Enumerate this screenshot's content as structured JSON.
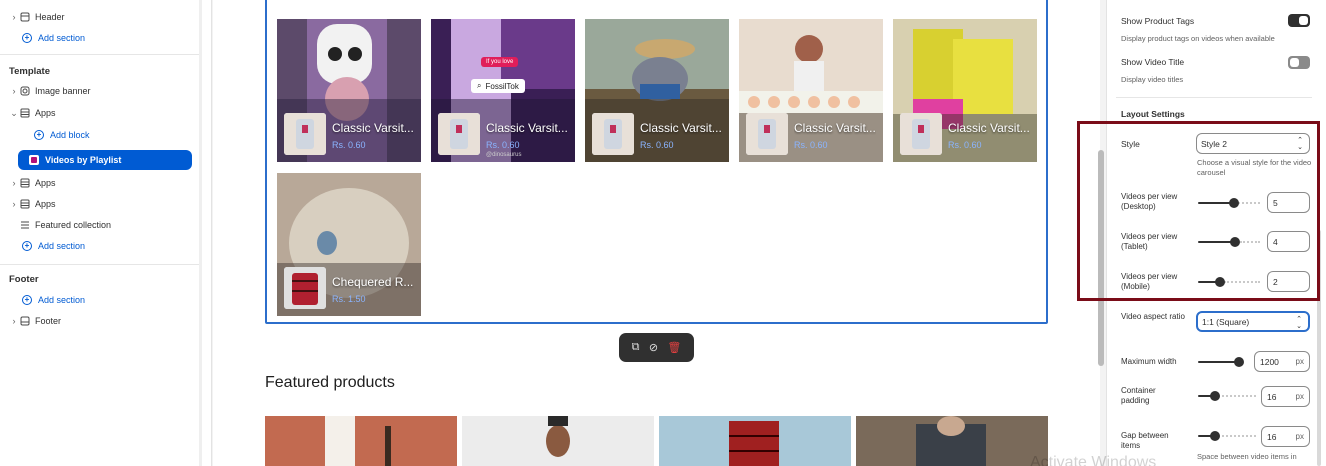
{
  "sidebar": {
    "header_item": "Header",
    "add_section_1": "Add section",
    "template_label": "Template",
    "image_banner": "Image banner",
    "apps_1": "Apps",
    "add_block": "Add block",
    "videos_by_playlist": "Videos by Playlist",
    "apps_2": "Apps",
    "apps_3": "Apps",
    "featured_collection": "Featured collection",
    "add_section_2": "Add section",
    "footer_label": "Footer",
    "add_section_3": "Add section",
    "footer_item": "Footer"
  },
  "preview": {
    "videos": [
      {
        "title": "Classic Varsit...",
        "price": "Rs. 0.60",
        "bg": "#7a5a8a"
      },
      {
        "title": "Classic Varsit...",
        "price": "Rs. 0.60",
        "bg": "#4a2a6a",
        "tag": "If you love",
        "overlay": "FossilTok",
        "handle": "@dinosaurus"
      },
      {
        "title": "Classic Varsit...",
        "price": "Rs. 0.60",
        "bg": "#6b7a6a"
      },
      {
        "title": "Classic Varsit...",
        "price": "Rs. 0.60",
        "bg": "#c9b8a8"
      },
      {
        "title": "Classic Varsit...",
        "price": "Rs. 0.60",
        "bg": "#8a8a3a"
      },
      {
        "title": "Chequered R...",
        "price": "Rs. 1.50",
        "bg": "#9a8a7a"
      }
    ],
    "featured_title": "Featured products"
  },
  "settings": {
    "show_product_tags": "Show Product Tags",
    "show_product_tags_desc": "Display product tags on videos when available",
    "show_video_title": "Show Video Title",
    "show_video_title_desc": "Display video titles",
    "layout_settings": "Layout Settings",
    "style_label": "Style",
    "style_value": "Style 2",
    "style_desc": "Choose a visual style for the video carousel",
    "vpv_desktop_label": "Videos per view (Desktop)",
    "vpv_desktop": "5",
    "vpv_tablet_label": "Videos per view (Tablet)",
    "vpv_tablet": "4",
    "vpv_mobile_label": "Videos per view (Mobile)",
    "vpv_mobile": "2",
    "aspect_label": "Video aspect ratio",
    "aspect_value": "1:1 (Square)",
    "max_width_label": "Maximum width",
    "max_width": "1200",
    "px": "px",
    "container_padding_label": "Container padding",
    "container_padding": "16",
    "gap_label": "Gap between items",
    "gap": "16",
    "gap_desc": "Space between video items in"
  },
  "watermark": "Activate Windows",
  "colors": {
    "accent": "#005bd3",
    "highlight": "#7a0c18",
    "frame": "#2c6ecb",
    "toggle_on": "#303030",
    "toggle_off": "#8a8a8a"
  }
}
